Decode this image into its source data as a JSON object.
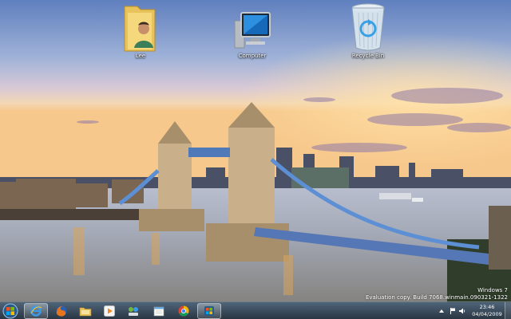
{
  "desktop": {
    "icons": [
      {
        "label": "Lee"
      },
      {
        "label": "Computer"
      },
      {
        "label": "Recycle Bin"
      }
    ]
  },
  "watermark": {
    "line1": "Windows 7",
    "line2": "Evaluation copy. Build 7068.winmain.090321-1322"
  },
  "taskbar": {
    "pinned": [
      {
        "icon": "internet-explorer-icon"
      },
      {
        "icon": "firefox-icon"
      },
      {
        "icon": "windows-explorer-icon"
      },
      {
        "icon": "media-player-icon"
      },
      {
        "icon": "network-icon"
      },
      {
        "icon": "notepad-icon"
      },
      {
        "icon": "chrome-icon"
      },
      {
        "icon": "windows-icon"
      }
    ],
    "clock": {
      "time": "23:46",
      "date": "04/04/2009"
    }
  },
  "colors": {
    "taskbar": "#2e4457",
    "accent": "#3aa0e6"
  }
}
